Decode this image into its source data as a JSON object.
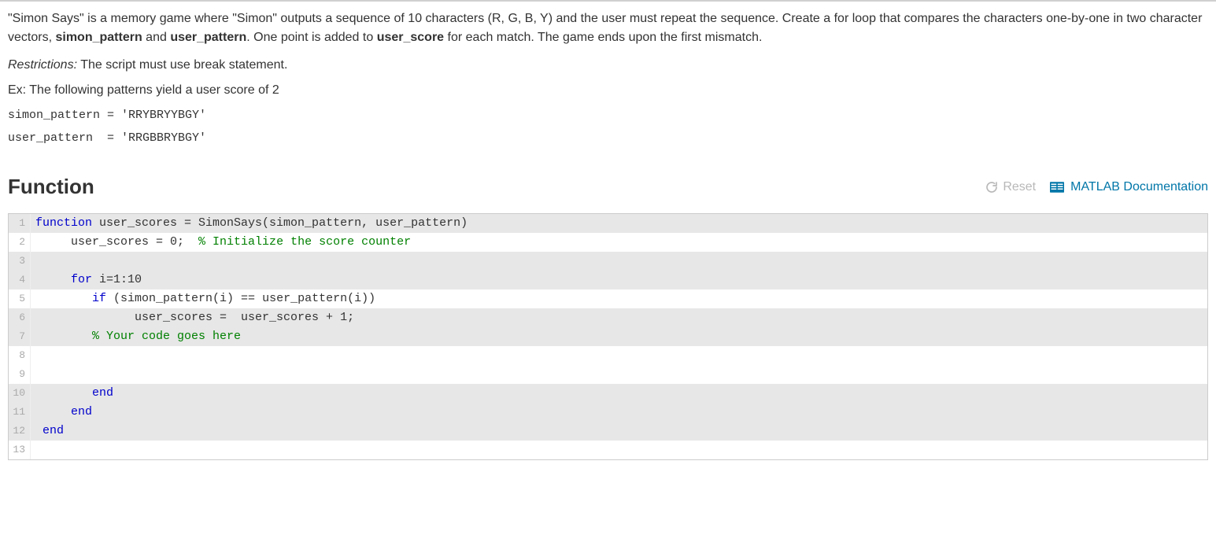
{
  "problem": {
    "intro_before_bold1": "\"Simon Says\" is a memory game where \"Simon\" outputs a sequence of 10 characters (R, G, B, Y) and the user must repeat the sequence. Create a for loop that compares the characters one-by-one in two character vectors, ",
    "bold1": "simon_pattern",
    "between1": " and ",
    "bold2": "user_pattern",
    "between2": ". One point is added to ",
    "bold3": "user_score",
    "after_bold3": " for each match. The game ends upon the first mismatch.",
    "restrictions_label": "Restrictions:",
    "restrictions_text": "  The script must use break statement.",
    "example_intro": "Ex: The following patterns yield a user score of 2",
    "example_line1": "simon_pattern = 'RRYBRYYBGY'",
    "example_line2": "user_pattern  = 'RRGBBRYBGY'"
  },
  "section": {
    "title": "Function",
    "reset_label": "Reset",
    "doc_label": "MATLAB Documentation"
  },
  "code": {
    "lines": [
      {
        "n": 1,
        "bg": "odd",
        "segs": [
          {
            "t": "function",
            "c": "kw"
          },
          {
            "t": " user_scores = SimonSays(simon_pattern, user_pattern)",
            "c": ""
          }
        ]
      },
      {
        "n": 2,
        "bg": "even",
        "segs": [
          {
            "t": "     user_scores = 0;  ",
            "c": ""
          },
          {
            "t": "% Initialize the score counter",
            "c": "cm"
          }
        ]
      },
      {
        "n": 3,
        "bg": "odd",
        "segs": [
          {
            "t": "",
            "c": ""
          }
        ]
      },
      {
        "n": 4,
        "bg": "odd",
        "segs": [
          {
            "t": "     ",
            "c": ""
          },
          {
            "t": "for",
            "c": "kw"
          },
          {
            "t": " i=1:10",
            "c": ""
          }
        ]
      },
      {
        "n": 5,
        "bg": "even",
        "segs": [
          {
            "t": "        ",
            "c": ""
          },
          {
            "t": "if",
            "c": "kw"
          },
          {
            "t": " (simon_pattern(i) == user_pattern(i))",
            "c": ""
          }
        ]
      },
      {
        "n": 6,
        "bg": "odd",
        "segs": [
          {
            "t": "              user_scores =  user_scores + 1;",
            "c": ""
          }
        ]
      },
      {
        "n": 7,
        "bg": "odd",
        "segs": [
          {
            "t": "        ",
            "c": ""
          },
          {
            "t": "% Your code goes here",
            "c": "cm"
          }
        ]
      },
      {
        "n": 8,
        "bg": "even",
        "segs": [
          {
            "t": "",
            "c": ""
          }
        ]
      },
      {
        "n": 9,
        "bg": "even",
        "segs": [
          {
            "t": "",
            "c": ""
          }
        ]
      },
      {
        "n": 10,
        "bg": "odd",
        "segs": [
          {
            "t": "        ",
            "c": ""
          },
          {
            "t": "end",
            "c": "kw"
          }
        ]
      },
      {
        "n": 11,
        "bg": "odd",
        "segs": [
          {
            "t": "     ",
            "c": ""
          },
          {
            "t": "end",
            "c": "kw"
          }
        ]
      },
      {
        "n": 12,
        "bg": "odd",
        "segs": [
          {
            "t": " ",
            "c": ""
          },
          {
            "t": "end",
            "c": "kw"
          }
        ]
      },
      {
        "n": 13,
        "bg": "even",
        "segs": [
          {
            "t": "",
            "c": ""
          }
        ]
      }
    ]
  }
}
